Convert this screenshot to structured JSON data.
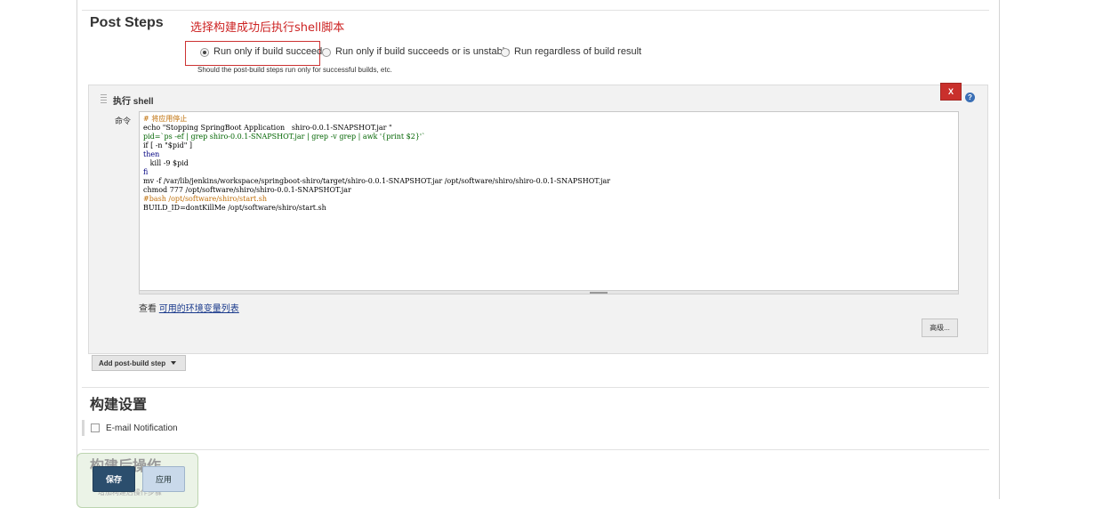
{
  "post_steps": {
    "title": "Post Steps",
    "annotation": "选择构建成功后执行shell脚本",
    "options": [
      {
        "label": "Run only if build succeeds",
        "selected": true
      },
      {
        "label": "Run only if build succeeds or is unstable",
        "selected": false
      },
      {
        "label": "Run regardless of build result",
        "selected": false
      }
    ],
    "help_text": "Should the post-build steps run only for successful builds, etc."
  },
  "shell_step": {
    "title": "执行 shell",
    "delete_label": "X",
    "help_icon": "?",
    "command_label": "命令",
    "code_lines": [
      {
        "text": "# 将应用停止",
        "color": "#c0700a"
      },
      {
        "text": "echo \"Stopping SpringBoot Application   shiro-0.0.1-SNAPSHOT.jar \"",
        "color": "#000000"
      },
      {
        "text": "pid=`ps -ef | grep shiro-0.0.1-SNAPSHOT.jar | grep -v grep | awk '{print $2}'`",
        "color": "#006400"
      },
      {
        "text": "if [ -n \"$pid\" ]",
        "color": "#000000"
      },
      {
        "text": "then",
        "color": "#000080"
      },
      {
        "text": "   kill -9 $pid",
        "color": "#000000"
      },
      {
        "text": "fi",
        "color": "#000080"
      },
      {
        "text": "mv -f /var/lib/jenkins/workspace/springboot-shiro/target/shiro-0.0.1-SNAPSHOT.jar /opt/software/shiro/shiro-0.0.1-SNAPSHOT.jar",
        "color": "#000000"
      },
      {
        "text": "chmod 777 /opt/software/shiro/shiro-0.0.1-SNAPSHOT.jar",
        "color": "#000000"
      },
      {
        "text": "#bash /opt/software/shiro/start.sh",
        "color": "#c0700a"
      },
      {
        "text": "BUILD_ID=dontKillMe /opt/software/shiro/start.sh",
        "color": "#000000"
      }
    ],
    "env_prefix": "查看",
    "env_link": "可用的环境变量列表",
    "advanced_label": "高级..."
  },
  "add_post_build_step": "Add post-build step",
  "build_settings": {
    "title": "构建设置",
    "email_label": "E-mail Notification"
  },
  "post_build": {
    "title": "构建后操作",
    "add_label": "增加构建后操作步骤"
  },
  "buttons": {
    "save": "保存",
    "apply": "应用"
  },
  "colors": {
    "annotation_red": "#cc2222",
    "delete_red": "#c9302c",
    "save_bg": "#2b4e6d",
    "apply_bg": "#c9d9ea",
    "link": "#1a3a8c"
  }
}
